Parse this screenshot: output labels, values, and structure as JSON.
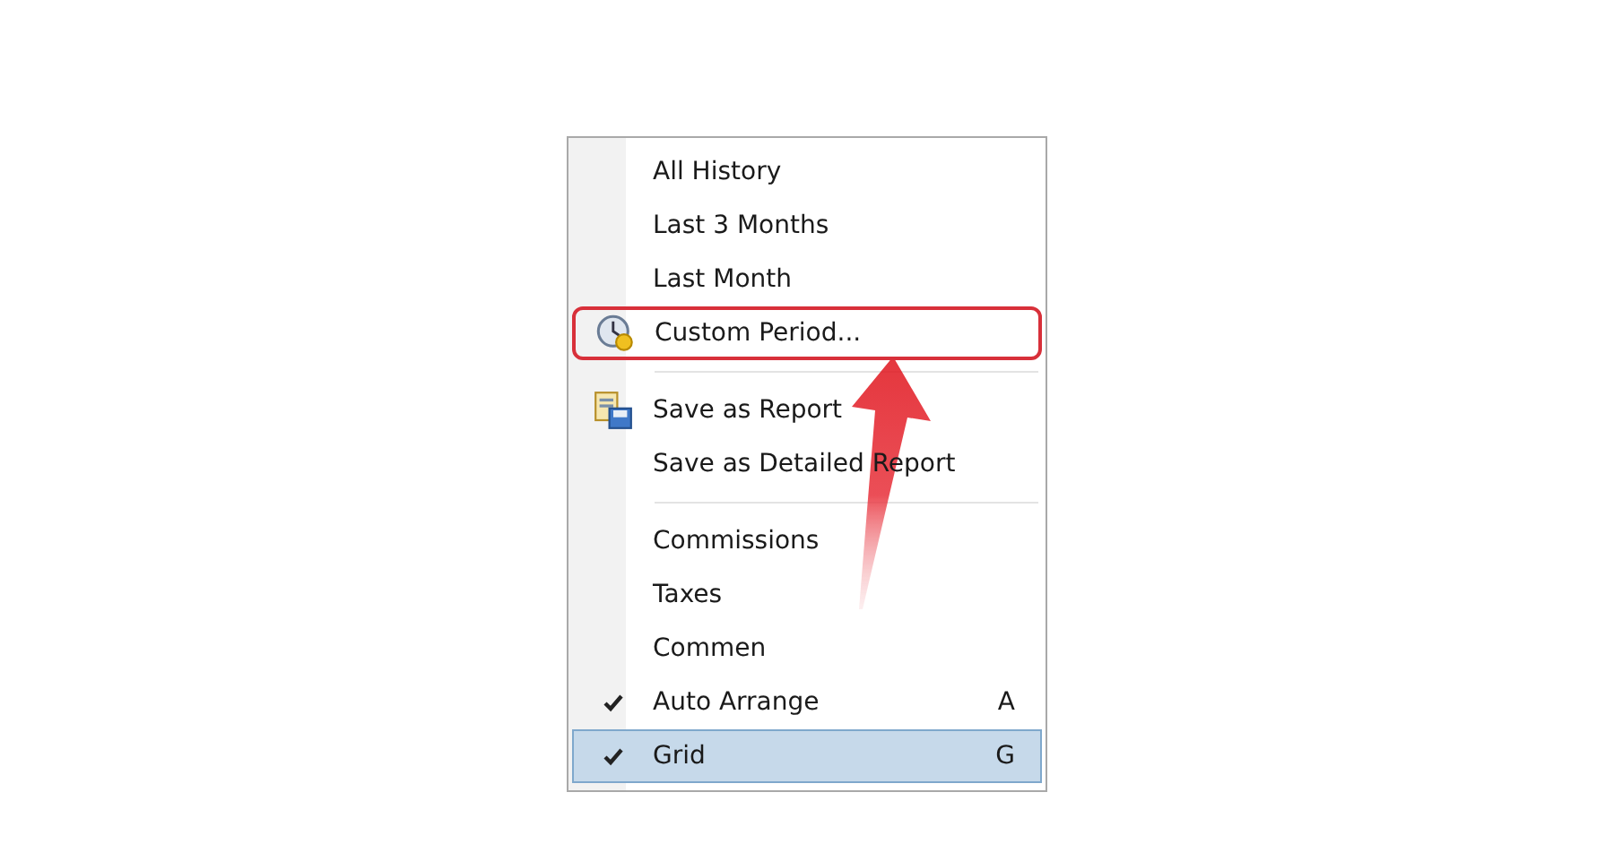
{
  "menu": {
    "items": [
      {
        "kind": "plain",
        "label": "All History",
        "checked": false,
        "selected": false,
        "annotated": false
      },
      {
        "kind": "plain",
        "label": "Last 3 Months",
        "checked": false,
        "selected": false,
        "annotated": false
      },
      {
        "kind": "plain",
        "label": "Last Month",
        "checked": false,
        "selected": false,
        "annotated": false
      },
      {
        "kind": "clock",
        "label": "Custom Period...",
        "checked": false,
        "selected": false,
        "annotated": true
      },
      {
        "kind": "separator"
      },
      {
        "kind": "report",
        "label": "Save as Report",
        "checked": false,
        "selected": false,
        "annotated": false
      },
      {
        "kind": "plain",
        "label": "Save as Detailed Report",
        "checked": false,
        "selected": false,
        "annotated": false
      },
      {
        "kind": "separator"
      },
      {
        "kind": "plain",
        "label": "Commissions",
        "checked": false,
        "selected": false,
        "annotated": false
      },
      {
        "kind": "plain",
        "label": "Taxes",
        "checked": false,
        "selected": false,
        "annotated": false
      },
      {
        "kind": "plain",
        "label": "Commen",
        "checked": false,
        "selected": false,
        "annotated": false
      },
      {
        "kind": "plain",
        "label": "Auto Arrange",
        "shortcut": "A",
        "checked": true,
        "selected": false,
        "annotated": false
      },
      {
        "kind": "plain",
        "label": "Grid",
        "shortcut": "G",
        "checked": true,
        "selected": true,
        "annotated": false
      }
    ]
  }
}
